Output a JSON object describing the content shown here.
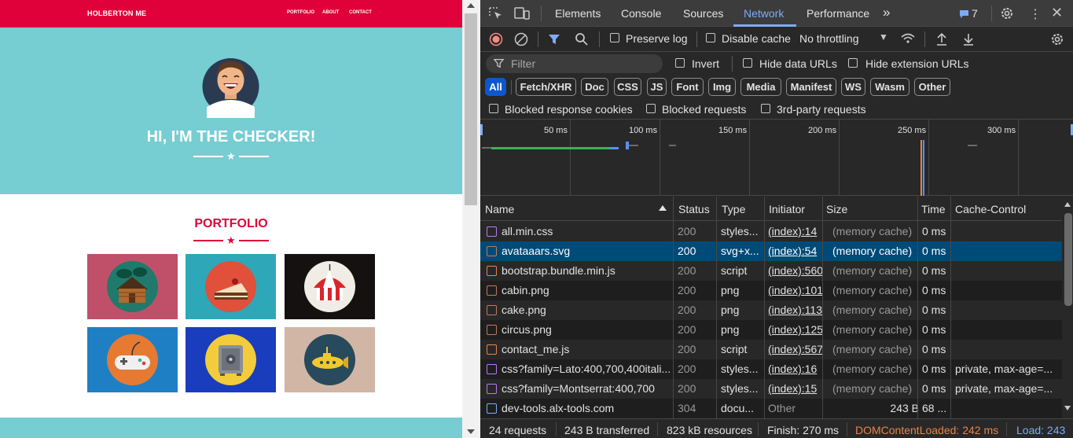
{
  "site": {
    "brand": "HOLBERTON ME",
    "nav": [
      "PORTFOLIO",
      "ABOUT",
      "CONTACT"
    ],
    "hero_title": "HI, I'M THE CHECKER!",
    "portfolio_title": "PORTFOLIO",
    "tiles": [
      {
        "name": "cabin",
        "bg": "#c0506a",
        "circle": "#1f7a6b"
      },
      {
        "name": "cake",
        "bg": "#2ea7b9",
        "circle": "#e0503a"
      },
      {
        "name": "circus",
        "bg": "#161111",
        "circle": "#f0ede6"
      },
      {
        "name": "game",
        "bg": "#1f7fc4",
        "circle": "#e67a33"
      },
      {
        "name": "safe",
        "bg": "#1a3dbd",
        "circle": "#f2cc3a"
      },
      {
        "name": "submarine",
        "bg": "#d1b6a5",
        "circle": "#274a5c"
      }
    ],
    "colors": {
      "primary": "#e0003a",
      "teal": "#76cdd2"
    }
  },
  "devtools": {
    "tabs": [
      "Elements",
      "Console",
      "Sources",
      "Network",
      "Performance"
    ],
    "active_tab": "Network",
    "issues_count": "7",
    "toolbar": {
      "preserve_log": "Preserve log",
      "disable_cache": "Disable cache",
      "throttling": "No throttling"
    },
    "filter": {
      "placeholder": "Filter",
      "invert": "Invert",
      "hide_data_urls": "Hide data URLs",
      "hide_extension_urls": "Hide extension URLs"
    },
    "type_filters": [
      "All",
      "Fetch/XHR",
      "Doc",
      "CSS",
      "JS",
      "Font",
      "Img",
      "Media",
      "Manifest",
      "WS",
      "Wasm",
      "Other"
    ],
    "block_filters": [
      "Blocked response cookies",
      "Blocked requests",
      "3rd-party requests"
    ],
    "timeline_ticks": [
      "50 ms",
      "100 ms",
      "150 ms",
      "200 ms",
      "250 ms",
      "300 ms"
    ],
    "columns": [
      "Name",
      "Status",
      "Type",
      "Initiator",
      "Size",
      "Time",
      "Cache-Control"
    ],
    "rows": [
      {
        "name": "all.min.css",
        "status": "200",
        "type": "styles...",
        "initiator": "(index):14",
        "size": "(memory cache)",
        "time": "0 ms",
        "cache": "",
        "icon": "css"
      },
      {
        "name": "avataaars.svg",
        "status": "200",
        "type": "svg+x...",
        "initiator": "(index):54",
        "size": "(memory cache)",
        "time": "0 ms",
        "cache": "",
        "icon": "img"
      },
      {
        "name": "bootstrap.bundle.min.js",
        "status": "200",
        "type": "script",
        "initiator": "(index):560",
        "size": "(memory cache)",
        "time": "0 ms",
        "cache": "",
        "icon": "js"
      },
      {
        "name": "cabin.png",
        "status": "200",
        "type": "png",
        "initiator": "(index):101",
        "size": "(memory cache)",
        "time": "0 ms",
        "cache": "",
        "icon": "img"
      },
      {
        "name": "cake.png",
        "status": "200",
        "type": "png",
        "initiator": "(index):113",
        "size": "(memory cache)",
        "time": "0 ms",
        "cache": "",
        "icon": "img"
      },
      {
        "name": "circus.png",
        "status": "200",
        "type": "png",
        "initiator": "(index):125",
        "size": "(memory cache)",
        "time": "0 ms",
        "cache": "",
        "icon": "img"
      },
      {
        "name": "contact_me.js",
        "status": "200",
        "type": "script",
        "initiator": "(index):567",
        "size": "(memory cache)",
        "time": "0 ms",
        "cache": "",
        "icon": "js"
      },
      {
        "name": "css?family=Lato:400,700,400itali...",
        "status": "200",
        "type": "styles...",
        "initiator": "(index):16",
        "size": "(memory cache)",
        "time": "0 ms",
        "cache": "private, max-age=...",
        "icon": "css"
      },
      {
        "name": "css?family=Montserrat:400,700",
        "status": "200",
        "type": "styles...",
        "initiator": "(index):15",
        "size": "(memory cache)",
        "time": "0 ms",
        "cache": "private, max-age=...",
        "icon": "css"
      },
      {
        "name": "dev-tools.alx-tools.com",
        "status": "304",
        "type": "docu...",
        "initiator": "Other",
        "size": "243 B",
        "time": "68 ...",
        "cache": "",
        "icon": "doc"
      }
    ],
    "status": {
      "requests": "24 requests",
      "transferred": "243 B transferred",
      "resources": "823 kB resources",
      "finish": "Finish: 270 ms",
      "dcl": "DOMContentLoaded: 242 ms",
      "load": "Load: 243"
    }
  }
}
